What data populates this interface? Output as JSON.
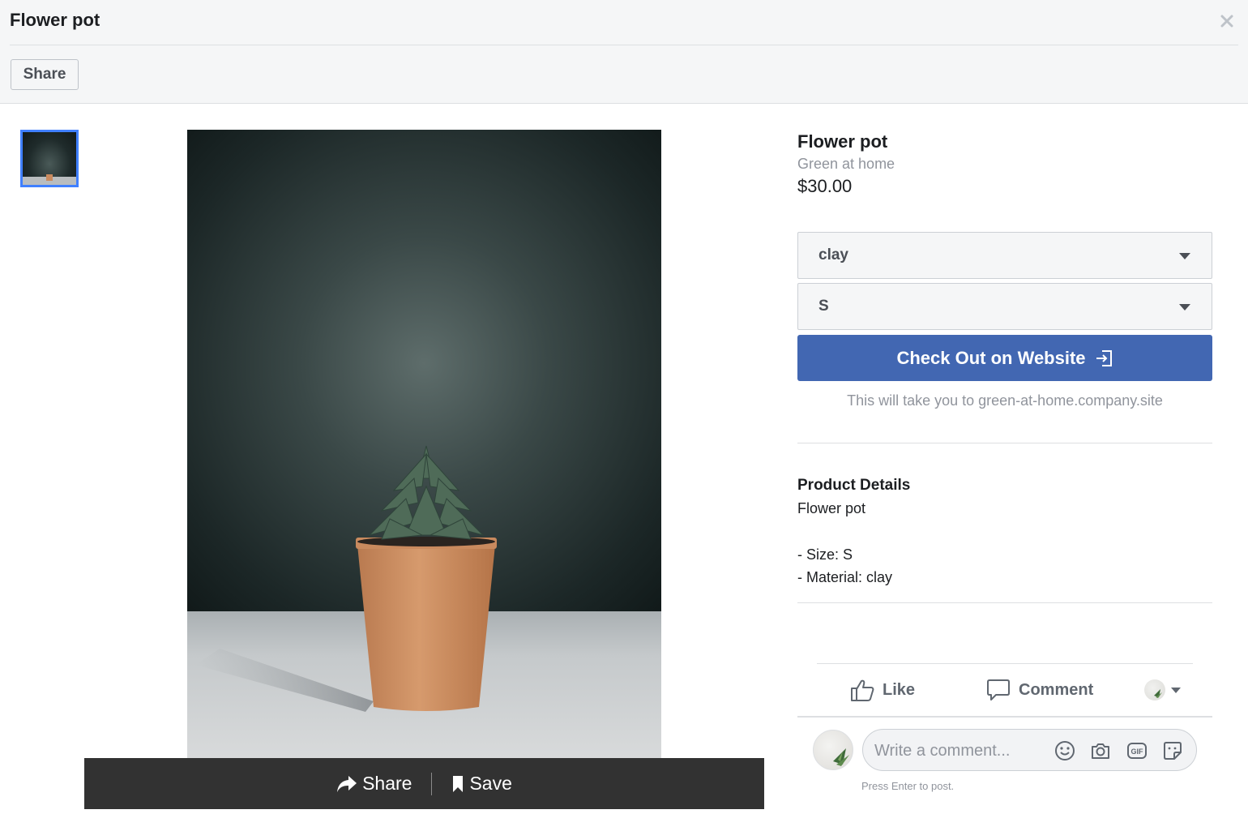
{
  "header": {
    "title": "Flower pot",
    "share_label": "Share"
  },
  "media": {
    "bar_share_label": "Share",
    "bar_save_label": "Save"
  },
  "product": {
    "title": "Flower pot",
    "shop": "Green at home",
    "price": "$30.00",
    "options": {
      "material_selected": "clay",
      "size_selected": "S"
    },
    "checkout_label": "Check Out on Website",
    "redirect_note": "This will take you to green-at-home.company.site"
  },
  "details": {
    "heading": "Product Details",
    "lines": [
      "Flower pot",
      "- Size: S",
      "- Material: clay"
    ]
  },
  "actions": {
    "like_label": "Like",
    "comment_label": "Comment"
  },
  "comment": {
    "placeholder": "Write a comment...",
    "hint": "Press Enter to post."
  },
  "colors": {
    "accent": "#4267b2",
    "thumb_border": "#4080ff",
    "media_bar": "#323232"
  }
}
